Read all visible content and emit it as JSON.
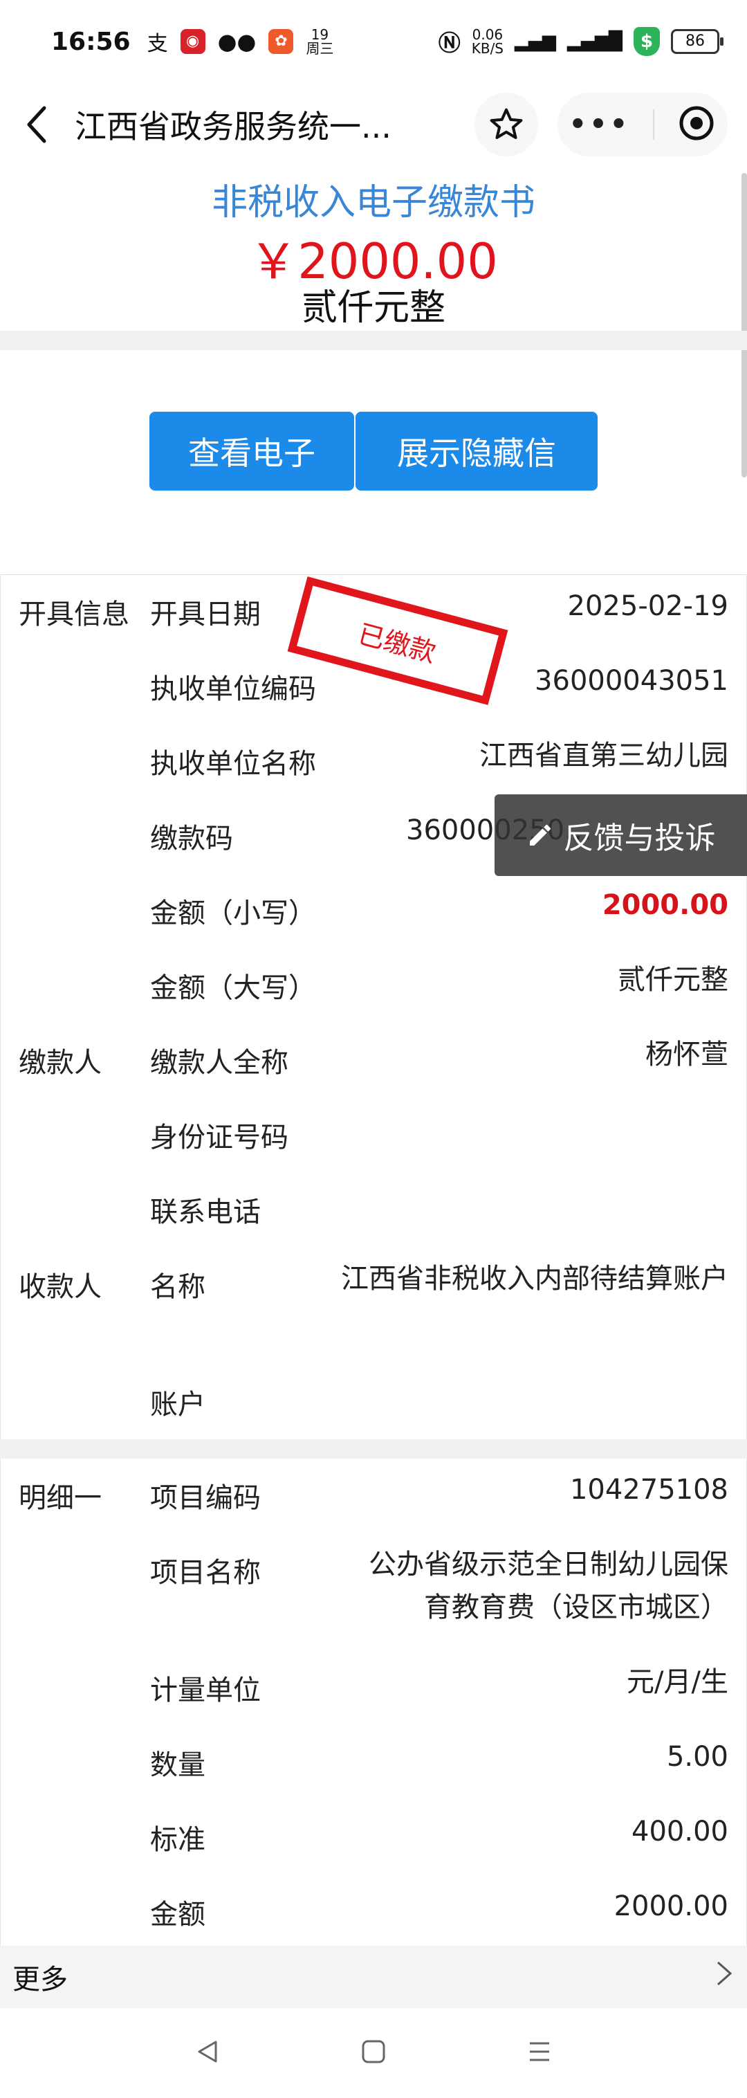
{
  "status_bar": {
    "time": "16:56",
    "net_speed": "0.06\nKB/S",
    "date_badge": "19\n周三",
    "battery": "86"
  },
  "nav": {
    "title": "江西省政务服务统一..."
  },
  "doc": {
    "title": "非税收入电子缴款书",
    "amount": "￥2000.00",
    "amount_upper": "贰仟元整"
  },
  "buttons": {
    "view_electronic": "查看电子",
    "show_hidden": "展示隐藏信"
  },
  "stamp": {
    "text": "已缴款"
  },
  "feedback": {
    "label": "反馈与投诉"
  },
  "sections": {
    "issue": {
      "category": "开具信息",
      "rows": [
        {
          "label": "开具日期",
          "value": "2025-02-19"
        },
        {
          "label": "执收单位编码",
          "value": "36000043051"
        },
        {
          "label": "执收单位名称",
          "value": "江西省直第三幼儿园"
        },
        {
          "label": "缴款码",
          "value": "360000250…"
        },
        {
          "label": "金额（小写）",
          "value": "2000.00"
        },
        {
          "label": "金额（大写）",
          "value": "贰仟元整"
        }
      ]
    },
    "payer": {
      "category": "缴款人",
      "rows": [
        {
          "label": "缴款人全称",
          "value": "杨怀萱"
        },
        {
          "label": "身份证号码",
          "value": ""
        },
        {
          "label": "联系电话",
          "value": ""
        }
      ]
    },
    "payee": {
      "category": "收款人",
      "rows": [
        {
          "label": "名称",
          "value": "江西省非税收入内部待结算账户"
        },
        {
          "label": "账户",
          "value": ""
        }
      ]
    },
    "detail": {
      "category": "明细一",
      "rows": [
        {
          "label": "项目编码",
          "value": "104275108"
        },
        {
          "label": "项目名称",
          "value": "公办省级示范全日制幼儿园保育教育费（设区市城区）"
        },
        {
          "label": "计量单位",
          "value": "元/月/生"
        },
        {
          "label": "数量",
          "value": "5.00"
        },
        {
          "label": "标准",
          "value": "400.00"
        },
        {
          "label": "金额",
          "value": "2000.00"
        }
      ]
    }
  },
  "more": {
    "label": "更多"
  },
  "colors": {
    "accent_blue": "#1c8ae8",
    "title_blue": "#3a86d6",
    "red": "#e0141c"
  }
}
